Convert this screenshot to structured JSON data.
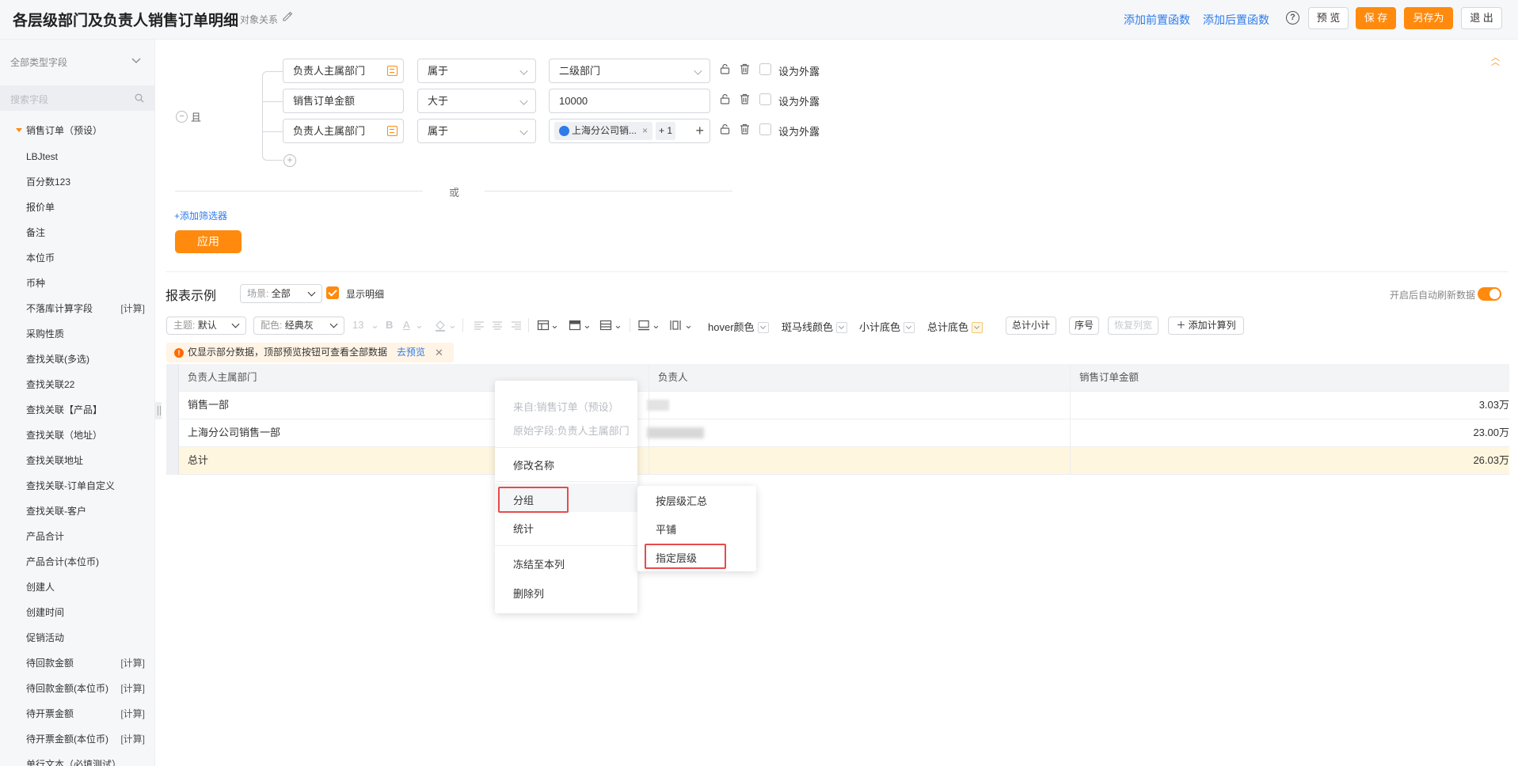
{
  "header": {
    "title": "各层级部门及负责人销售订单明细",
    "relation": "对象关系",
    "add_pre_func": "添加前置函数",
    "add_post_func": "添加后置函数",
    "help": "?",
    "preview": "预 览",
    "save": "保 存",
    "save_as": "另存为",
    "exit": "退 出"
  },
  "sidebar": {
    "type_label": "全部类型字段",
    "search_placeholder": "搜索字段",
    "group": "销售订单（预设）",
    "items": [
      {
        "label": "LBJtest",
        "tag": ""
      },
      {
        "label": "百分数123",
        "tag": ""
      },
      {
        "label": "报价单",
        "tag": ""
      },
      {
        "label": "备注",
        "tag": ""
      },
      {
        "label": "本位币",
        "tag": ""
      },
      {
        "label": "币种",
        "tag": ""
      },
      {
        "label": "不落库计算字段",
        "tag": "[计算]"
      },
      {
        "label": "采购性质",
        "tag": ""
      },
      {
        "label": "查找关联(多选)",
        "tag": ""
      },
      {
        "label": "查找关联22",
        "tag": ""
      },
      {
        "label": "查找关联【产品】",
        "tag": ""
      },
      {
        "label": "查找关联（地址）",
        "tag": ""
      },
      {
        "label": "查找关联地址",
        "tag": ""
      },
      {
        "label": "查找关联-订单自定义",
        "tag": ""
      },
      {
        "label": "查找关联-客户",
        "tag": ""
      },
      {
        "label": "产品合计",
        "tag": ""
      },
      {
        "label": "产品合计(本位币)",
        "tag": ""
      },
      {
        "label": "创建人",
        "tag": ""
      },
      {
        "label": "创建时间",
        "tag": ""
      },
      {
        "label": "促销活动",
        "tag": ""
      },
      {
        "label": "待回款金额",
        "tag": "[计算]"
      },
      {
        "label": "待回款金额(本位币)",
        "tag": "[计算]"
      },
      {
        "label": "待开票金额",
        "tag": "[计算]"
      },
      {
        "label": "待开票金额(本位币)",
        "tag": "[计算]"
      },
      {
        "label": "单行文本（必填测试）",
        "tag": ""
      }
    ]
  },
  "filter": {
    "and_label": "且",
    "or_label": "或",
    "rows": [
      {
        "field": "负责人主属部门",
        "op": "属于",
        "value": "二级部门",
        "expose": "设为外露"
      },
      {
        "field": "销售订单金额",
        "op": "大于",
        "value": "10000",
        "expose": "设为外露"
      },
      {
        "field": "负责人主属部门",
        "op": "属于",
        "value": "",
        "expose": "设为外露"
      }
    ],
    "chip_text": "上海分公司销...",
    "chip_more": "+ 1",
    "add_filter": "+添加筛选器",
    "apply": "应用"
  },
  "report": {
    "title": "报表示例",
    "scene_label": "场景:",
    "scene_value": "全部",
    "show_detail": "显示明细",
    "auto_refresh": "开启后自动刷新数据"
  },
  "toolbar": {
    "theme_label": "主题:",
    "theme_value": "默认",
    "color_label": "配色:",
    "color_value": "经典灰",
    "font_size": "13",
    "bold": "B",
    "font_color": "A",
    "hover_color": "hover颜色",
    "zebra_color": "斑马线颜色",
    "subtotal_bg": "小计底色",
    "total_bg": "总计底色",
    "total_subtotal": "总计小计",
    "serial": "序号",
    "restore_width": "恢复列宽",
    "add_calc_col": "添加计算列"
  },
  "notice": {
    "text": "仅显示部分数据，顶部预览按钮可查看全部数据",
    "link": "去预览"
  },
  "table": {
    "headers": [
      "负责人主属部门",
      "负责人",
      "销售订单金额"
    ],
    "rows": [
      {
        "dept": "销售一部",
        "owner": "",
        "amount": "3.03万"
      },
      {
        "dept": "上海分公司销售一部",
        "owner": "",
        "amount": "23.00万"
      }
    ],
    "total": {
      "label": "总计",
      "amount": "26.03万"
    }
  },
  "context_menu": {
    "from": "来自:销售订单（预设）",
    "origin": "原始字段:负责人主属部门",
    "rename": "修改名称",
    "group": "分组",
    "stat": "统计",
    "freeze": "冻结至本列",
    "delete": "删除列"
  },
  "submenu": {
    "by_level": "按层级汇总",
    "flat": "平铺",
    "specify_level": "指定层级"
  }
}
